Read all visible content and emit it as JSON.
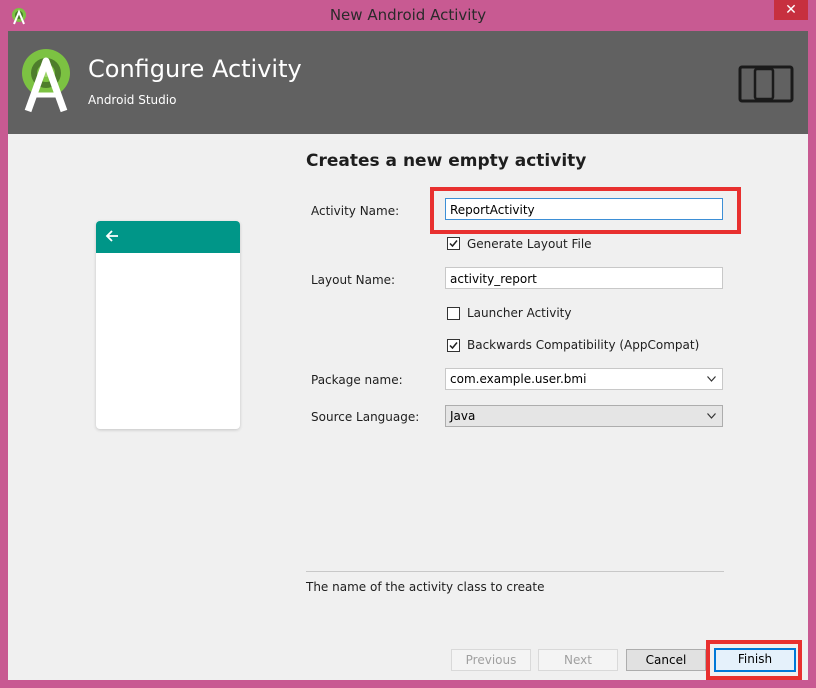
{
  "window": {
    "title": "New Android Activity",
    "close_glyph": "✕"
  },
  "header": {
    "title": "Configure Activity",
    "subtitle": "Android Studio",
    "logo_icon": "android-studio-icon",
    "device_icon": "tablet-phone-icon"
  },
  "preview": {
    "toolbar_color": "#009688",
    "back_icon": "arrow-left-icon"
  },
  "form": {
    "heading": "Creates a new empty activity",
    "activity_name_label": "Activity Name:",
    "activity_name_value": "ReportActivity",
    "generate_layout_label": "Generate Layout File",
    "generate_layout_checked": true,
    "layout_name_label": "Layout Name:",
    "layout_name_value": "activity_report",
    "launcher_label": "Launcher Activity",
    "launcher_checked": false,
    "backwards_label": "Backwards Compatibility (AppCompat)",
    "backwards_checked": true,
    "package_label": "Package name:",
    "package_value": "com.example.user.bmi",
    "language_label": "Source Language:",
    "language_value": "Java"
  },
  "description": "The name of the activity class to create",
  "buttons": {
    "previous": "Previous",
    "next": "Next",
    "cancel": "Cancel",
    "finish": "Finish"
  },
  "colors": {
    "window_frame": "#c85a92",
    "header_bg": "#616161",
    "highlight": "#e8302f",
    "focus": "#3d8fd6"
  }
}
